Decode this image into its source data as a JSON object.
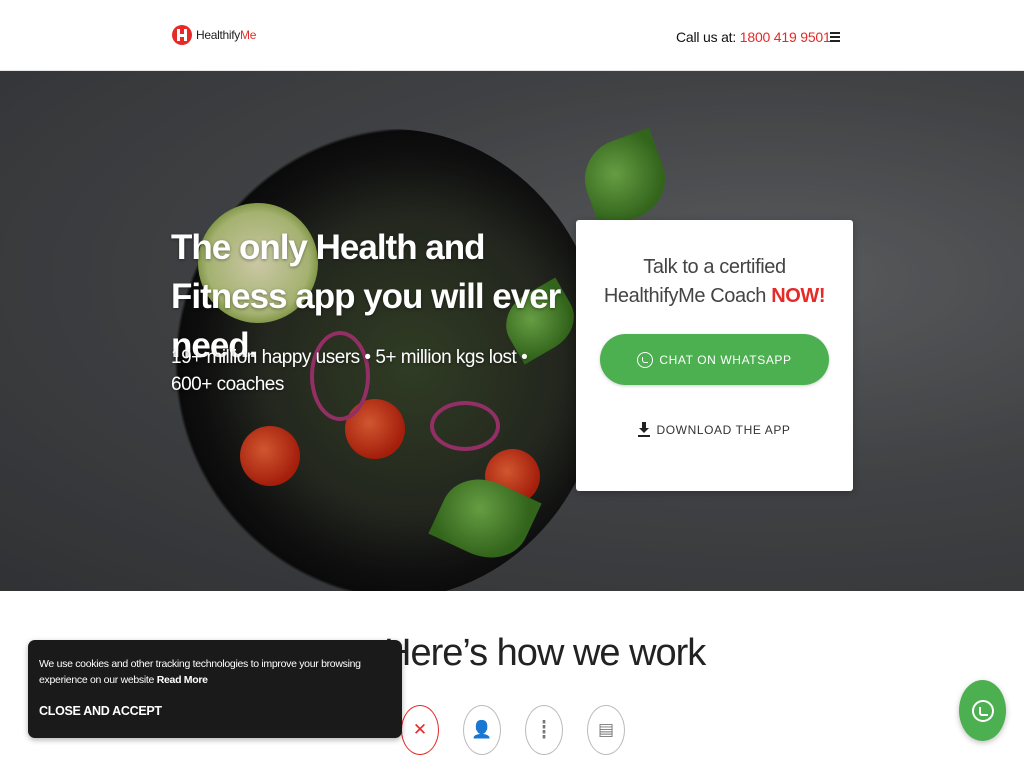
{
  "header": {
    "logo": {
      "brand_main": "Healthify",
      "brand_accent": "Me"
    },
    "call_label": "Call us at:",
    "phone": "1800 419 9501",
    "menu_icon": "hamburger-icon"
  },
  "hero": {
    "title": "The only Health and Fitness app you will ever need.",
    "subtitle": "19+ million happy users • 5+ million kgs lost • 600+ coaches"
  },
  "card": {
    "title_line1": "Talk to a certified",
    "title_line2": "HealthifyMe Coach",
    "title_accent": "NOW!",
    "whatsapp_label": "CHAT ON WHATSAPP",
    "download_label": "DOWNLOAD THE APP"
  },
  "how": {
    "title": "Here’s how we work",
    "steps": [
      {
        "icon": "fork-knife-icon",
        "glyph": "✕",
        "active": true
      },
      {
        "icon": "person-icon",
        "glyph": "👤",
        "active": false
      },
      {
        "icon": "audio-wave-icon",
        "glyph": "┋",
        "active": false
      },
      {
        "icon": "document-icon",
        "glyph": "▤",
        "active": false
      }
    ]
  },
  "cookie": {
    "text": "We use cookies and other tracking technologies to improve your browsing experience on our website",
    "read_more": "Read More",
    "accept": "CLOSE AND ACCEPT"
  },
  "fab": {
    "icon": "whatsapp-icon"
  },
  "colors": {
    "brand_red": "#e52a28",
    "whatsapp_green": "#4caf50",
    "cookie_bg": "#1a1a1a"
  }
}
